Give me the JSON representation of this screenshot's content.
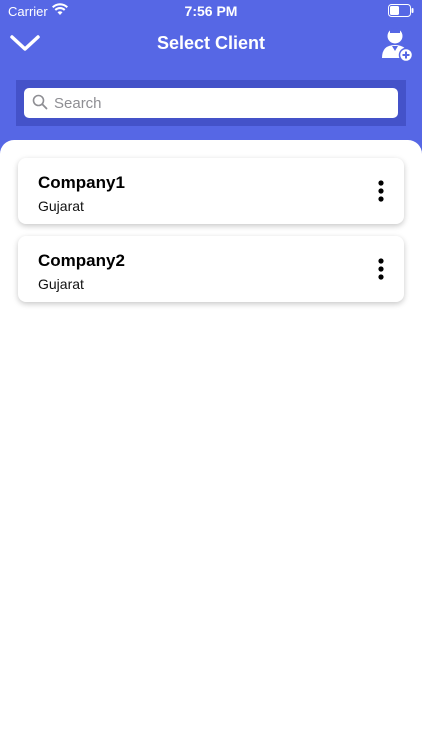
{
  "status_bar": {
    "carrier": "Carrier",
    "time": "7:56 PM"
  },
  "nav": {
    "title": "Select Client"
  },
  "search": {
    "placeholder": "Search",
    "value": ""
  },
  "clients": [
    {
      "name": "Company1",
      "location": "Gujarat"
    },
    {
      "name": "Company2",
      "location": "Gujarat"
    }
  ],
  "icons": {
    "back": "chevron-down-icon",
    "add_client": "add-user-icon",
    "search": "search-icon",
    "more": "more-vertical-icon"
  },
  "colors": {
    "header": "#5667e5",
    "search_bar": "#4452c9"
  }
}
